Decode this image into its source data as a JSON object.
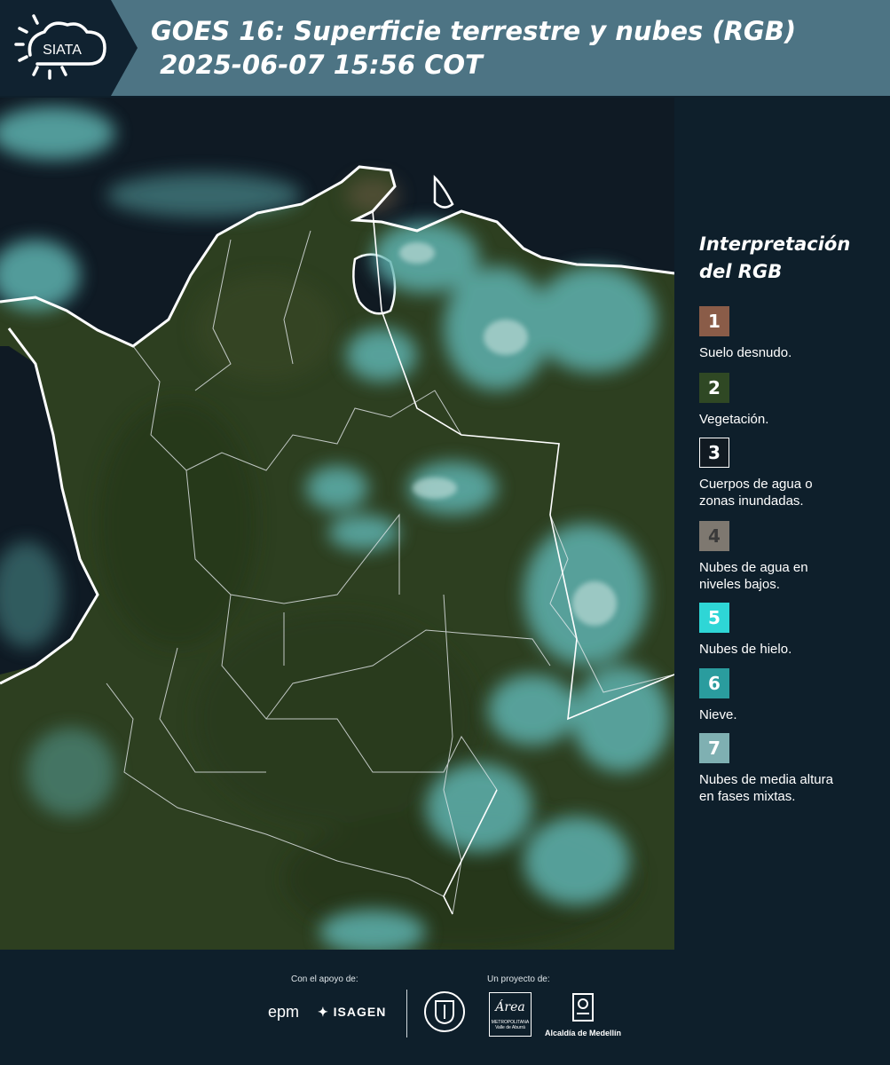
{
  "header": {
    "logo_text": "SIATA",
    "title_line1": "GOES 16: Superficie terrestre y nubes (RGB)",
    "title_line2": " 2025-06-07 15:56 COT"
  },
  "legend": {
    "title_line1": "Interpretación",
    "title_line2": "del RGB",
    "items": [
      {
        "number": "1",
        "label_line1": "Suelo desnudo.",
        "label_line2": "",
        "color": "#8a5c48",
        "text_color": "#ffffff"
      },
      {
        "number": "2",
        "label_line1": "Vegetación.",
        "label_line2": "",
        "color": "#2f4824",
        "text_color": "#ffffff"
      },
      {
        "number": "3",
        "label_line1": "Cuerpos de agua o",
        "label_line2": "zonas inundadas.",
        "color": "#111a22",
        "text_color": "#ffffff"
      },
      {
        "number": "4",
        "label_line1": "Nubes de agua en",
        "label_line2": "niveles bajos.",
        "color": "#7e7870",
        "text_color": "#3a3a3a"
      },
      {
        "number": "5",
        "label_line1": "Nubes de hielo.",
        "label_line2": "",
        "color": "#2ed6d6",
        "text_color": "#ffffff"
      },
      {
        "number": "6",
        "label_line1": "Nieve.",
        "label_line2": "",
        "color": "#2a9c9e",
        "text_color": "#ffffff"
      },
      {
        "number": "7",
        "label_line1": "Nubes de media altura",
        "label_line2": "en fases mixtas.",
        "color": "#7fb0b2",
        "text_color": "#ffffff"
      }
    ]
  },
  "footer": {
    "support_label": "Con el apoyo de:",
    "project_label": "Un proyecto de:",
    "epm": "epm",
    "isagen": "ISAGEN",
    "area_name": "Área",
    "area_sub1": "METROPOLITANA",
    "area_sub2": "Valle de Aburrá",
    "alcaldia": "Alcaldía de Medellín"
  },
  "colors": {
    "header_bg": "#4d7484",
    "page_bg": "#0e1f2b",
    "land": "#2f4420",
    "ocean": "#0d1822",
    "cloud": "#5fb9b4"
  }
}
